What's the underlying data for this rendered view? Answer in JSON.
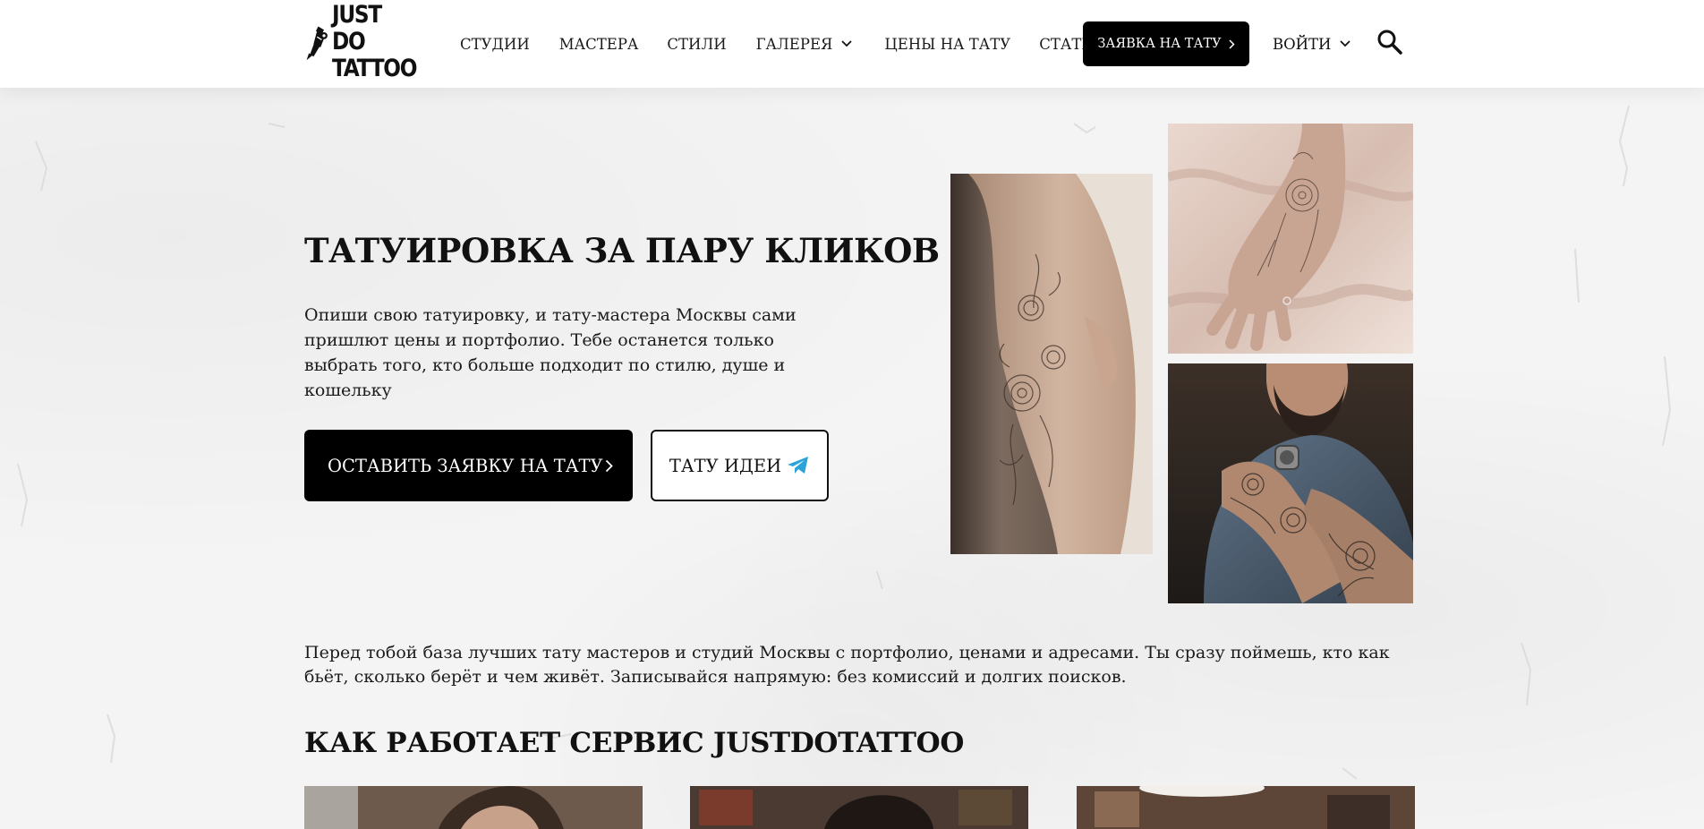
{
  "header": {
    "logo": {
      "alt": "JUST DO TATTOO",
      "line1": "JUST DO",
      "line2": "TATTOO",
      "icon": "tattoo-machine-icon"
    },
    "nav": [
      {
        "label": "СТУДИИ"
      },
      {
        "label": "МАСТЕРА"
      },
      {
        "label": "СТИЛИ"
      },
      {
        "label": "ГАЛЕРЕЯ",
        "icon": "chevron-down-icon"
      },
      {
        "label": "ЦЕНЫ НА ТАТУ"
      },
      {
        "label": "СТАТЬИ"
      }
    ],
    "cta_label": "ЗАЯВКА НА ТАТУ",
    "login_label": "ВОЙТИ",
    "search_icon": "search-icon"
  },
  "hero": {
    "title": "ТАТУИРОВКА ЗА ПАРУ КЛИКОВ",
    "description": "Опиши свою татуировку, и тату-мастера Москвы сами пришлют цены и портфолио. Тебе останется только выбрать того, кто больше подходит по стилю, душе и кошельку",
    "primary_button": "ОСТАВИТЬ ЗАЯВКУ НА ТАТУ",
    "secondary_button": "ТАТУ ИДЕИ",
    "secondary_icon": "telegram-icon"
  },
  "intro": {
    "text": "Перед тобой база лучших тату мастеров и студий Москвы с портфолио, ценами и адресами. Ты сразу поймешь, кто как бьёт, сколько берёт и чем живёт. Записывайся напрямую: без комиссий и долгих поисков."
  },
  "how_it_works": {
    "title": "КАК РАБОТАЕТ СЕРВИС JUSTDOTATTOO"
  },
  "colors": {
    "accent": "#000000",
    "background": "#f4f4f4",
    "telegram": "#2aa3d8"
  }
}
